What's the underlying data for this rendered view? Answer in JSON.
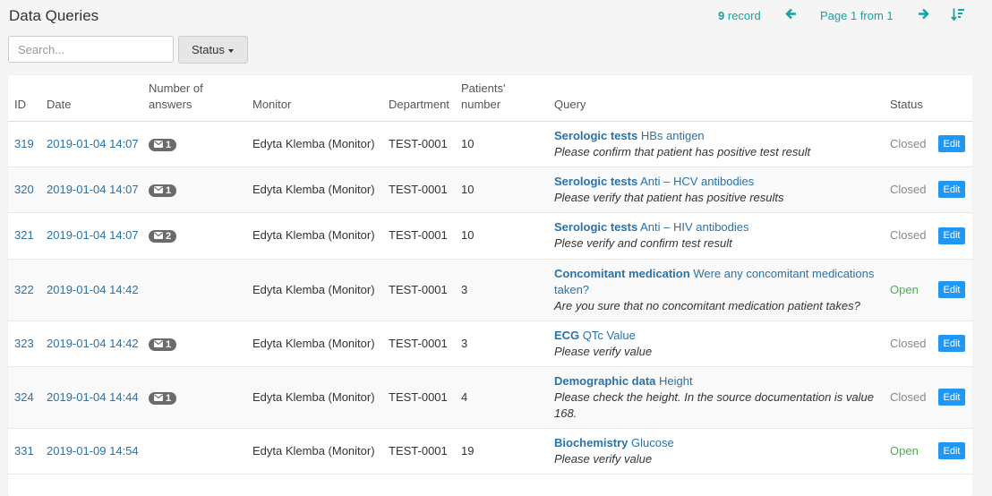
{
  "page": {
    "title": "Data Queries"
  },
  "pager": {
    "record_count": "9",
    "record_label": "record",
    "page_text": "Page 1 from 1"
  },
  "search": {
    "placeholder": "Search..."
  },
  "filter": {
    "status_label": "Status"
  },
  "colors": {
    "link": "#2a72a8",
    "accent_teal": "#17a2a2",
    "edit_button": "#2196f3",
    "open_status": "#4caf50",
    "closed_status": "#888888",
    "badge": "#6b6b6b"
  },
  "icons": {
    "prev": "arrow-left-icon",
    "next": "arrow-right-icon",
    "sort": "sort-icon",
    "answers": "envelope-icon"
  },
  "table": {
    "headers": {
      "id": "ID",
      "date": "Date",
      "answers": "Number of answers",
      "monitor": "Monitor",
      "department": "Department",
      "patients": "Patients' number",
      "query": "Query",
      "status": "Status"
    },
    "rows": [
      {
        "id": "319",
        "date": "2019-01-04 14:07",
        "answers": "1",
        "monitor": "Edyta Klemba (Monitor)",
        "department": "TEST-0001",
        "patients": "10",
        "query_category": "Serologic tests",
        "query_subject": "HBs antigen",
        "query_text": "Please confirm that patient has positive test result",
        "status": "Closed",
        "edit_label": "Edit"
      },
      {
        "id": "320",
        "date": "2019-01-04 14:07",
        "answers": "1",
        "monitor": "Edyta Klemba (Monitor)",
        "department": "TEST-0001",
        "patients": "10",
        "query_category": "Serologic tests",
        "query_subject": "Anti – HCV antibodies",
        "query_text": "Please verify that patient has positive results",
        "status": "Closed",
        "edit_label": "Edit"
      },
      {
        "id": "321",
        "date": "2019-01-04 14:07",
        "answers": "2",
        "monitor": "Edyta Klemba (Monitor)",
        "department": "TEST-0001",
        "patients": "10",
        "query_category": "Serologic tests",
        "query_subject": "Anti – HIV antibodies",
        "query_text": "Plese verify and confirm test result",
        "status": "Closed",
        "edit_label": "Edit"
      },
      {
        "id": "322",
        "date": "2019-01-04 14:42",
        "answers": "",
        "monitor": "Edyta Klemba (Monitor)",
        "department": "TEST-0001",
        "patients": "3",
        "query_category": "Concomitant medication",
        "query_subject": "Were any concomitant medications taken?",
        "query_text": "Are you sure that no concomitant medication patient takes?",
        "status": "Open",
        "edit_label": "Edit"
      },
      {
        "id": "323",
        "date": "2019-01-04 14:42",
        "answers": "1",
        "monitor": "Edyta Klemba (Monitor)",
        "department": "TEST-0001",
        "patients": "3",
        "query_category": "ECG",
        "query_subject": "QTc Value",
        "query_text": "Please verify value",
        "status": "Closed",
        "edit_label": "Edit"
      },
      {
        "id": "324",
        "date": "2019-01-04 14:44",
        "answers": "1",
        "monitor": "Edyta Klemba (Monitor)",
        "department": "TEST-0001",
        "patients": "4",
        "query_category": "Demographic data",
        "query_subject": "Height",
        "query_text": "Please check the height. In the source documentation is value 168.",
        "status": "Closed",
        "edit_label": "Edit"
      },
      {
        "id": "331",
        "date": "2019-01-09 14:54",
        "answers": "",
        "monitor": "Edyta Klemba (Monitor)",
        "department": "TEST-0001",
        "patients": "19",
        "query_category": "Biochemistry",
        "query_subject": "Glucose",
        "query_text": "Please verify value",
        "status": "Open",
        "edit_label": "Edit"
      }
    ]
  }
}
